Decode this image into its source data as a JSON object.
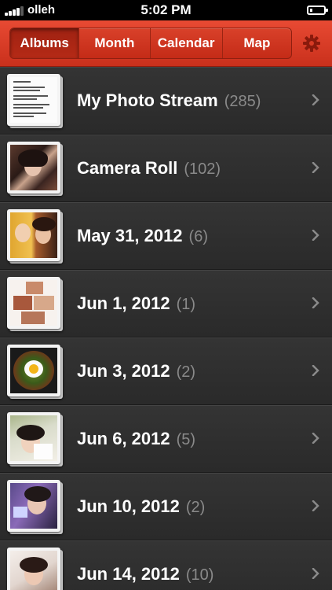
{
  "status_bar": {
    "carrier": "olleh",
    "time": "5:02 PM",
    "battery_level": 0.2
  },
  "header": {
    "tabs": [
      {
        "label": "Albums",
        "selected": true
      },
      {
        "label": "Month",
        "selected": false
      },
      {
        "label": "Calendar",
        "selected": false
      },
      {
        "label": "Map",
        "selected": false
      }
    ],
    "settings_icon": "gear-icon",
    "accent_color": "#d63b24"
  },
  "albums": [
    {
      "title": "My Photo Stream",
      "count": "(285)"
    },
    {
      "title": "Camera Roll",
      "count": "(102)"
    },
    {
      "title": "May 31, 2012",
      "count": "(6)"
    },
    {
      "title": "Jun 1, 2012",
      "count": "(1)"
    },
    {
      "title": "Jun 3, 2012",
      "count": "(2)"
    },
    {
      "title": "Jun 6, 2012",
      "count": "(5)"
    },
    {
      "title": "Jun 10, 2012",
      "count": "(2)"
    },
    {
      "title": "Jun 14, 2012",
      "count": "(10)"
    }
  ]
}
